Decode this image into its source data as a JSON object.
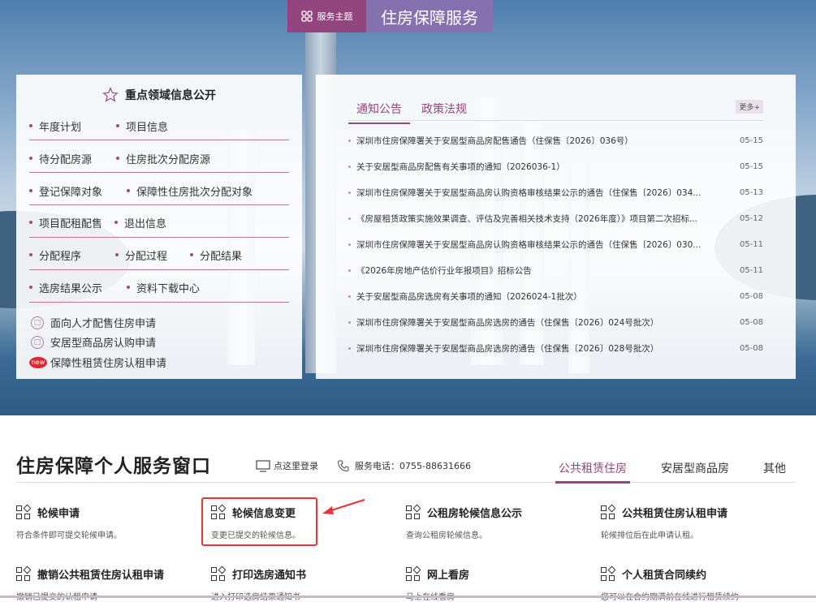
{
  "theme": {
    "tag_label": "服务主题",
    "title": "住房保障服务"
  },
  "left_panel": {
    "title": "重点领域信息公开",
    "rows": [
      [
        "年度计划",
        "项目信息"
      ],
      [
        "待分配房源",
        "住房批次分配房源"
      ],
      [
        "登记保障对象",
        "保障性住房批次分配对象"
      ],
      [
        "项目配租配售",
        "退出信息"
      ],
      [
        "分配程序",
        "分配过程",
        "分配结果"
      ],
      [
        "选房结果公示",
        "资料下载中心"
      ]
    ],
    "applications": [
      {
        "label": "面向人才配售住房申请",
        "icon": "document-circle-icon"
      },
      {
        "label": "安居型商品房认购申请",
        "icon": "document-circle-icon"
      },
      {
        "label": "保障性租赁住房认租申请",
        "icon": "new-badge-icon",
        "badge": "new"
      }
    ]
  },
  "news_panel": {
    "tabs": [
      "通知公告",
      "政策法规"
    ],
    "more_label": "更多+",
    "items": [
      {
        "title": "深圳市住房保障署关于安居型商品房配售通告（住保售〔2026〕036号）",
        "date": "05-15"
      },
      {
        "title": "关于安居型商品房配售有关事项的通知（2026036-1）",
        "date": "05-15"
      },
      {
        "title": "深圳市住房保障署关于安居型商品房认购资格审核结果公示的通告（住保售〔2026〕034...",
        "date": "05-13"
      },
      {
        "title": "《房屋租赁政策实施效果调查、评估及完善相关技术支持（2026年度）》项目第二次招标...",
        "date": "05-12"
      },
      {
        "title": "深圳市住房保障署关于安居型商品房认购资格审核结果公示的通告（住保售〔2026〕030...",
        "date": "05-11"
      },
      {
        "title": "《2026年房地产估价行业年报项目》招标公告",
        "date": "05-11"
      },
      {
        "title": "关于安居型商品房选房有关事项的通知（2026024-1批次）",
        "date": "05-08"
      },
      {
        "title": "深圳市住房保障署关于安居型商品房选房的通告（住保售〔2026〕024号批次）",
        "date": "05-08"
      },
      {
        "title": "深圳市住房保障署关于安居型商品房选房的通告（住保售〔2026〕028号批次）",
        "date": "05-08"
      }
    ]
  },
  "service_window": {
    "title": "住房保障个人服务窗口",
    "login_label": "点这里登录",
    "phone_label": "服务电话：0755-88631666",
    "tabs": [
      "公共租赁住房",
      "安居型商品房",
      "其他"
    ],
    "active_tab": "公共租赁住房",
    "services": [
      {
        "title": "轮候申请",
        "desc": "符合条件即可提交轮候申请。"
      },
      {
        "title": "轮候信息变更",
        "desc": "变更已提交的轮候信息。",
        "highlighted": true
      },
      {
        "title": "公租房轮候信息公示",
        "desc": "查询公租房轮候信息。"
      },
      {
        "title": "公共租赁住房认租申请",
        "desc": "轮候排位后在此申请认租。"
      },
      {
        "title": "撤销公共租赁住房认租申请",
        "desc": "撤销已提交的认租申请"
      },
      {
        "title": "打印选房通知书",
        "desc": "进入打印选房结果通知书"
      },
      {
        "title": "网上看房",
        "desc": "马上在线看房"
      },
      {
        "title": "个人租赁合同续约",
        "desc": "您可以在合约期满前在线进行租赁续约"
      }
    ]
  },
  "colors": {
    "brand_purple": "#93467e",
    "brand_lavender": "#8571b0",
    "highlight_red": "#e2353c"
  }
}
